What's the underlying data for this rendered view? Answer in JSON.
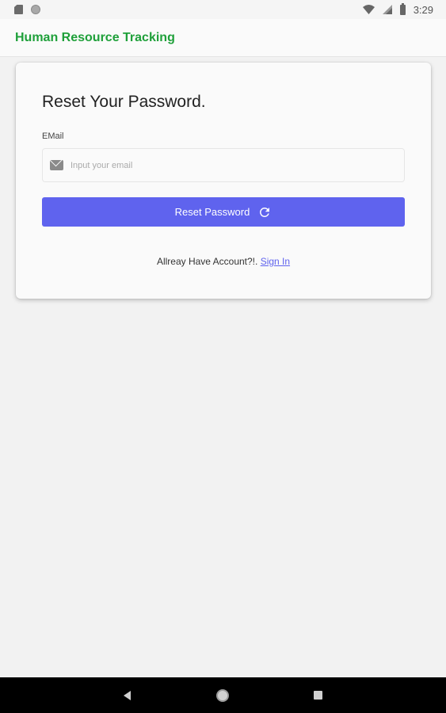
{
  "status_bar": {
    "time": "3:29",
    "icons": [
      "sd-card-icon",
      "circle-icon",
      "wifi-icon",
      "signal-icon",
      "battery-icon"
    ]
  },
  "app_bar": {
    "title": "Human Resource Tracking",
    "title_color": "#1fa03a"
  },
  "card": {
    "title": "Reset Your Password.",
    "email": {
      "label": "EMail",
      "placeholder": "Input your email",
      "value": "",
      "icon": "mail-icon"
    },
    "reset_button": {
      "label": "Reset Password",
      "icon": "refresh-icon",
      "color": "#5f63ee"
    },
    "signin": {
      "prompt": "Allreay Have Account?!.",
      "link_label": "Sign In"
    }
  },
  "nav_bar": {
    "icons": [
      "back-icon",
      "home-icon",
      "recents-icon"
    ]
  }
}
